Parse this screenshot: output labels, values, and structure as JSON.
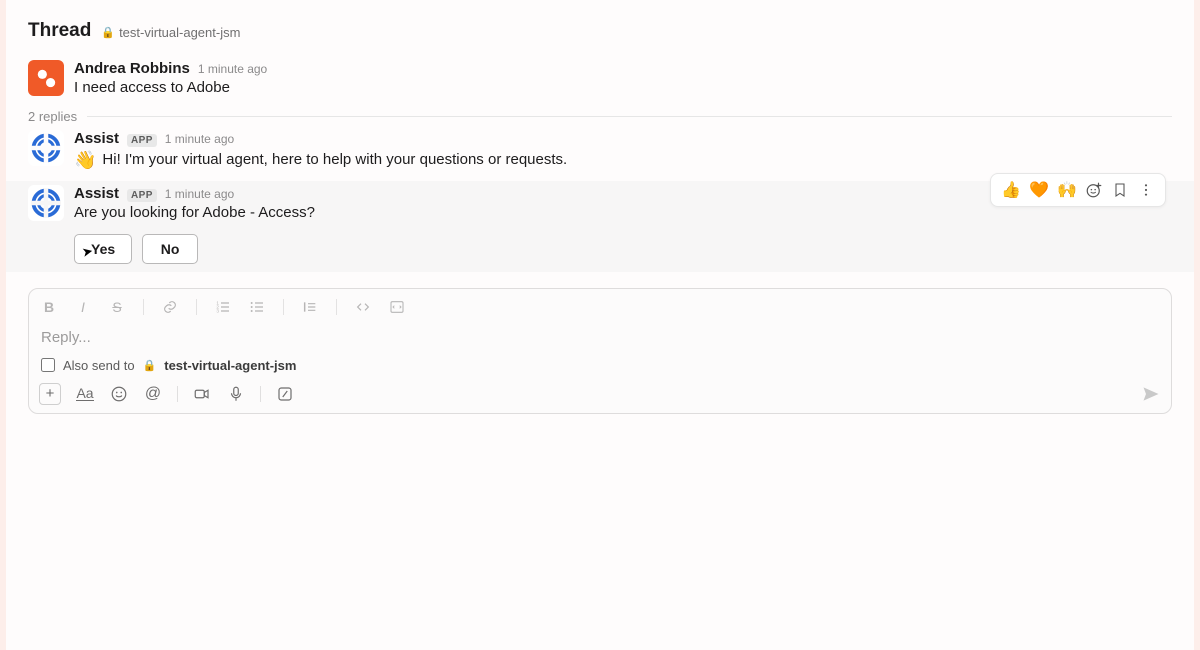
{
  "header": {
    "title": "Thread",
    "channel": "test-virtual-agent-jsm"
  },
  "original_message": {
    "author": "Andrea Robbins",
    "timestamp": "1 minute ago",
    "text": "I need access to Adobe"
  },
  "replies_label": "2 replies",
  "replies": [
    {
      "author": "Assist",
      "app_badge": "APP",
      "timestamp": "1 minute ago",
      "emoji": "👋",
      "text": "Hi! I'm your virtual agent, here to help with your questions or requests."
    },
    {
      "author": "Assist",
      "app_badge": "APP",
      "timestamp": "1 minute ago",
      "text": "Are you looking for Adobe - Access?",
      "buttons": {
        "yes": "Yes",
        "no": "No"
      }
    }
  ],
  "hover_reactions": [
    "👍",
    "🧡",
    "🙌"
  ],
  "composer": {
    "placeholder": "Reply...",
    "also_send_prefix": "Also send to",
    "also_send_channel": "test-virtual-agent-jsm"
  }
}
